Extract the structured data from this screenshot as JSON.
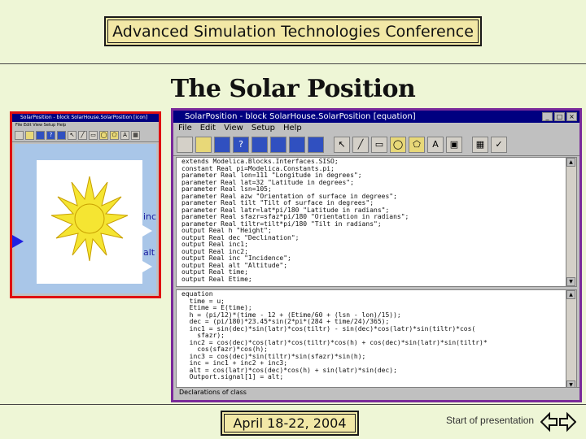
{
  "header": {
    "conference": "Advanced Simulation Technologies Conference"
  },
  "slide": {
    "title": "The Solar Position"
  },
  "diagram_window": {
    "title": "SolarPosition - block SolarHouse.SolarPosition [icon]",
    "menu": "File  Edit  View  Setup  Help",
    "toolbar_text": "A",
    "port_inc": "inc",
    "port_alt": "alt"
  },
  "editor_window": {
    "title": "SolarPosition - block SolarHouse.SolarPosition [equation]",
    "menu": [
      "File",
      "Edit",
      "View",
      "Setup",
      "Help"
    ],
    "declarations": "extends Modelica.Blocks.Interfaces.SISO;\nconstant Real pi=Modelica.Constants.pi;\nparameter Real lon=111 \"Longitude in degrees\";\nparameter Real lat=32 \"Latitude in degrees\";\nparameter Real lsn=105;\nparameter Real azw \"Orientation of surface in degrees\";\nparameter Real tilt \"Tilt of surface in degrees\";\nparameter Real latr=lat*pi/180 \"Latitude in radians\";\nparameter Real sfazr=sfaz*pi/180 \"Orientation in radians\";\nparameter Real tiltr=tilt*pi/180 \"Tilt in radians\";\noutput Real h \"Height\";\noutput Real dec \"Declination\";\noutput Real inc1;\noutput Real inc2;\noutput Real inc \"Incidence\";\noutput Real alt \"Altitude\";\noutput Real time;\noutput Real Etime;",
    "equations": "equation\n  time = u;\n  Etime = E(time);\n  h = (pi/12)*(time - 12 + (Etime/60 + (lsn - lon)/15));\n  dec = (pi/180)*23.45*sin(2*pi*(284 + time/24)/365);\n  inc1 = sin(dec)*sin(latr)*cos(tiltr) - sin(dec)*cos(latr)*sin(tiltr)*cos(\n    sfazr);\n  inc2 = cos(dec)*cos(latr)*cos(tiltr)*cos(h) + cos(dec)*sin(latr)*sin(tiltr)*\n    cos(sfazr)*cos(h);\n  inc3 = cos(dec)*sin(tiltr)*sin(sfazr)*sin(h);\n  inc = inc1 + inc2 + inc3;\n  alt = cos(latr)*cos(dec)*cos(h) + sin(latr)*sin(dec);\n  Outport.signal[1] = alt;",
    "status": "Declarations of class"
  },
  "footer": {
    "date": "April 18-22, 2004",
    "start_link": "Start of presentation"
  },
  "colors": {
    "background": "#eef6d6",
    "banner": "#f2e8a6",
    "sun": "#f5e532"
  },
  "icons": {
    "nav_prev": "left-arrow-icon",
    "nav_next": "right-arrow-icon"
  }
}
